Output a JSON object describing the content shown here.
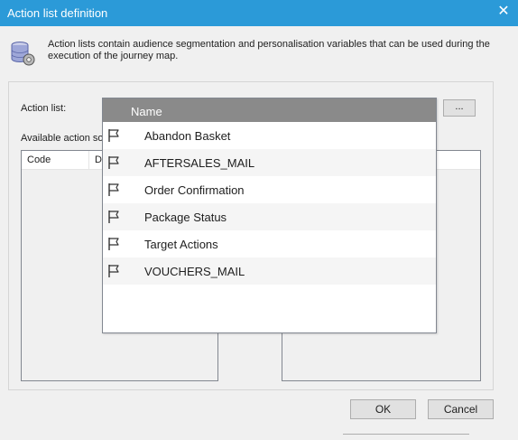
{
  "window": {
    "title": "Action list definition",
    "close_glyph": "✕"
  },
  "info": {
    "icon": "database-gear-icon",
    "text": "Action lists contain audience segmentation and personalisation variables that can be used during the execution of the journey map."
  },
  "form": {
    "action_list_label": "Action list:",
    "browse_label": "...",
    "available_label": "Available action so",
    "left_columns": [
      "Code",
      "D"
    ]
  },
  "dropdown": {
    "header": "Name",
    "items": [
      {
        "name": "Abandon Basket",
        "icon": "flag-icon"
      },
      {
        "name": "AFTERSALES_MAIL",
        "icon": "flag-icon"
      },
      {
        "name": "Order Confirmation",
        "icon": "flag-icon"
      },
      {
        "name": "Package Status",
        "icon": "flag-icon"
      },
      {
        "name": "Target Actions",
        "icon": "flag-icon"
      },
      {
        "name": "VOUCHERS_MAIL",
        "icon": "flag-icon"
      }
    ]
  },
  "buttons": {
    "ok": "OK",
    "cancel": "Cancel"
  },
  "colors": {
    "titlebar": "#2b9ad8",
    "dropdown_header": "#8a8a8a"
  }
}
